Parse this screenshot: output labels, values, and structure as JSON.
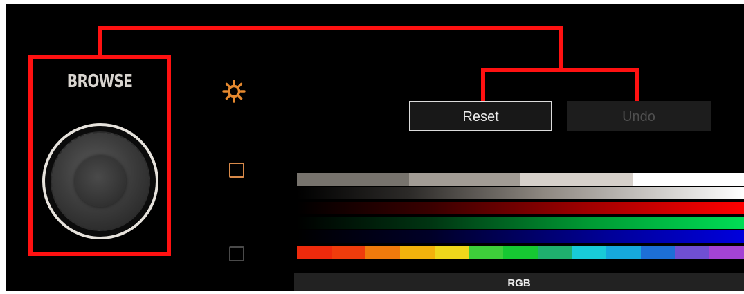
{
  "browse": {
    "label": "BROWSE"
  },
  "buttons": {
    "reset_label": "Reset",
    "undo_label": "Undo"
  },
  "icons": {
    "gear": "gear-icon",
    "square_active": "square-button-icon",
    "square_inactive": "square-button-icon"
  },
  "colors": {
    "callout": "#ff1111",
    "gear": "#e6892f",
    "square_active": "#d88a4a",
    "square_inactive": "#4a4a4a",
    "background": "#000000"
  },
  "palette": {
    "grays": [
      "#77736d",
      "#a29c95",
      "#d6d0ca",
      "#ffffff"
    ],
    "hues": [
      "#ee2a0c",
      "#ef3c0c",
      "#f07a0c",
      "#f3b20c",
      "#efd71b",
      "#3ecf3a",
      "#16c832",
      "#1fb06e",
      "#18cbd8",
      "#16a8dd",
      "#1d6fd6",
      "#6f4fd2",
      "#a443d4"
    ]
  },
  "mode": {
    "label": "RGB"
  }
}
